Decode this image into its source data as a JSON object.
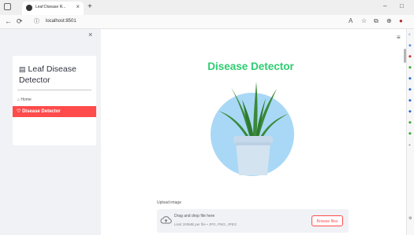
{
  "browser": {
    "tab_title": "Leaf Disease R...",
    "tab_close": "×",
    "new_tab": "+",
    "url": "localhost:8501",
    "window_controls": [
      "–",
      "□"
    ]
  },
  "sidebar": {
    "close_symbol": "×",
    "brand_title": "Leaf Disease Detector",
    "items": [
      {
        "label": "Home"
      },
      {
        "label": "Disease Detector",
        "active": true
      }
    ]
  },
  "main": {
    "title": "Disease Detector",
    "upload_label": "Upload image",
    "dropzone_text": "Drag and drop file here",
    "dropzone_hint": "Limit 200MB per file • JPG, PNG, JPEG",
    "browse_label": "Browse files"
  },
  "colors": {
    "accent": "#ff4b4b",
    "title_green": "#2ecc71",
    "plant_circle": "#a9d8f6",
    "pot": "#d3e3f0",
    "leaves": "#3a8a3a"
  }
}
